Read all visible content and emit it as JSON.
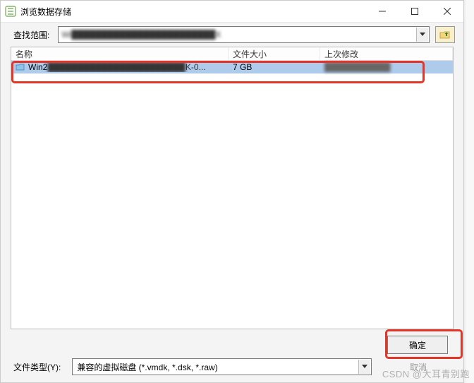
{
  "window": {
    "title": "浏览数据存储"
  },
  "toolbar": {
    "search_label": "查找范围:",
    "path_prefix": "Wi",
    "path_rest": "████████████████████████",
    "path_suffix": "X"
  },
  "columns": {
    "name": "名称",
    "size": "文件大小",
    "modified": "上次修改"
  },
  "rows": [
    {
      "name_prefix": "Win2",
      "name_hidden": "███████████████████████",
      "name_suffix": "K-0...",
      "size": "7 GB",
      "modified": "███████████"
    }
  ],
  "bottom": {
    "filetype_label": "文件类型(Y):",
    "filetype_value": "兼容的虚拟磁盘 (*.vmdk, *.dsk, *.raw)",
    "ok": "确定",
    "cancel": "取消"
  },
  "watermark": "CSDN @大耳青别跑"
}
